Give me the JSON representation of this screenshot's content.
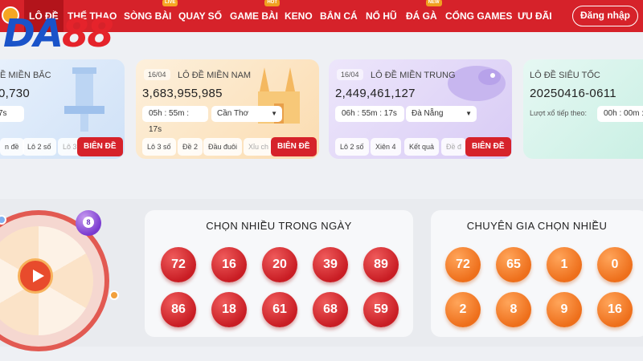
{
  "nav": {
    "items": [
      {
        "label": "LÔ ĐỀ",
        "active": true
      },
      {
        "label": "THỂ THAO"
      },
      {
        "label": "SÒNG BÀI",
        "badge": "LIVE"
      },
      {
        "label": "QUAY SỐ"
      },
      {
        "label": "GAME BÀI",
        "badge": "HOT"
      },
      {
        "label": "KENO"
      },
      {
        "label": "BẮN CÁ"
      },
      {
        "label": "NỔ HŨ"
      },
      {
        "label": "ĐÁ GÀ",
        "badge": "NEW"
      },
      {
        "label": "CỔNG GAMES"
      },
      {
        "label": "ƯU ĐÃI"
      }
    ],
    "login_label": "Đăng nhập"
  },
  "logo": {
    "part1": "DA",
    "part2": "88"
  },
  "cards": [
    {
      "name": "Ề MIỀN BẮC",
      "amount": "0,730",
      "timer": "7s",
      "chips": [
        "n đề",
        "Lô 2 số",
        "Lô 3"
      ],
      "bet_label": "BIÊN ĐỀ"
    },
    {
      "date": "16/04",
      "name": "LÔ ĐỀ MIỀN NAM",
      "amount": "3,683,955,985",
      "timer": "05h : 55m : 17s",
      "region": "Cần Thơ",
      "chips": [
        "Lô 3 số",
        "Đề 2",
        "Đầu đuôi",
        "Xỉu ch"
      ],
      "bet_label": "BIÊN ĐỀ"
    },
    {
      "date": "16/04",
      "name": "LÔ ĐỀ MIỀN TRUNG",
      "amount": "2,449,461,127",
      "timer": "06h : 55m : 17s",
      "region": "Đà Nẵng",
      "chips": [
        "Lô 2 số",
        "Xiên 4",
        "Kết quả",
        "Đề đ"
      ],
      "bet_label": "BIÊN ĐỀ"
    },
    {
      "name": "LÔ ĐỀ SIÊU TỐC",
      "amount": "20250416-0611",
      "next_label": "Lượt xổ tiếp theo:",
      "timer": "00h : 00m :"
    }
  ],
  "panels": {
    "left": {
      "title": "CHỌN NHIỀU TRONG NGÀY",
      "numbers": [
        "72",
        "16",
        "20",
        "39",
        "89",
        "86",
        "18",
        "61",
        "68",
        "59"
      ]
    },
    "right": {
      "title": "CHUYÊN GIA CHỌN NHIỀU",
      "numbers": [
        "72",
        "65",
        "1",
        "0",
        "2",
        "8",
        "9",
        "16"
      ]
    }
  },
  "wheel": {
    "ball_number": "8"
  },
  "colors": {
    "brand_red": "#d6222a",
    "logo_blue": "#1a53c9"
  }
}
